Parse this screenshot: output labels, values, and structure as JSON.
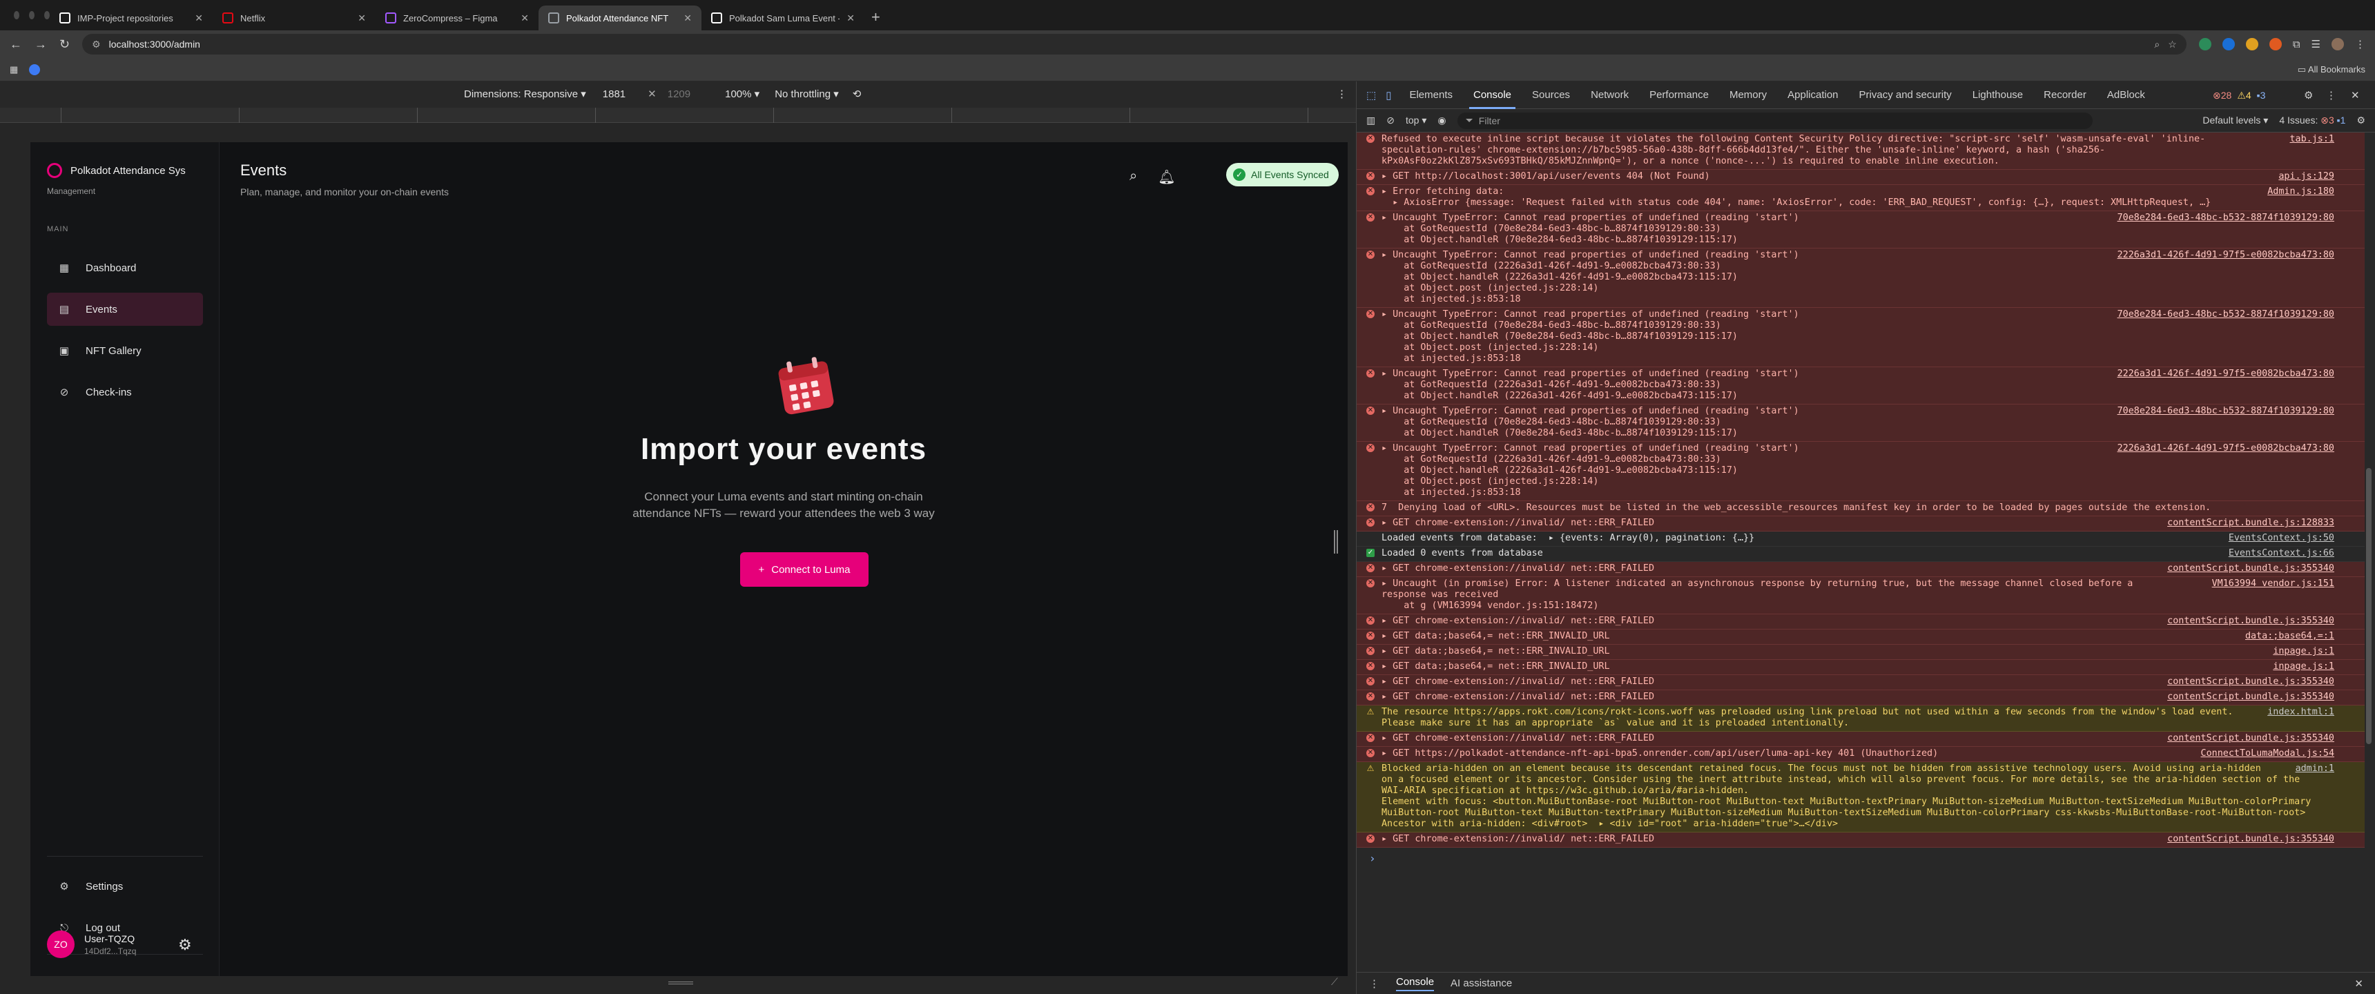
{
  "browser": {
    "tabs": [
      {
        "title": "IMP-Project repositories",
        "icon": "github-icon",
        "color": "#ffffff",
        "active": false
      },
      {
        "title": "Netflix",
        "icon": "netflix-icon",
        "color": "#e50914",
        "active": false
      },
      {
        "title": "ZeroCompress – Figma",
        "icon": "figma-icon",
        "color": "#a259ff",
        "active": false
      },
      {
        "title": "Polkadot Attendance NFT",
        "icon": "page-icon",
        "color": "#9aa0a6",
        "active": true
      },
      {
        "title": "Polkadot Sam Luma Event - L",
        "icon": "page-icon",
        "color": "#ffffff",
        "active": false
      }
    ],
    "url": "localhost:3000/admin",
    "bookmarks_label": "All Bookmarks"
  },
  "device_toolbar": {
    "dimensions_label": "Dimensions: Responsive",
    "width": "1881",
    "height": "1209",
    "zoom": "100%",
    "throttling": "No throttling"
  },
  "app": {
    "brand": "Polkadot Attendance Sys",
    "brand_sub": "Management",
    "section_main": "MAIN",
    "nav": [
      {
        "label": "Dashboard",
        "icon": "grid-icon"
      },
      {
        "label": "Events",
        "icon": "calendar-icon"
      },
      {
        "label": "NFT Gallery",
        "icon": "image-icon"
      },
      {
        "label": "Check-ins",
        "icon": "checkin-icon"
      }
    ],
    "settings": "Settings",
    "logout": "Log out",
    "user": {
      "initials": "ZO",
      "name": "User-TQZQ",
      "address": "14Ddf2...Tqzq"
    },
    "page_title": "Events",
    "page_subtitle": "Plan, manage, and monitor your on-chain events",
    "sync_badge": "All Events Synced",
    "empty_title": "Import your events",
    "empty_desc_1": "Connect your Luma events and start minting on-chain",
    "empty_desc_2": "attendance NFTs — reward your attendees the web 3 way",
    "connect_button": "Connect to Luma",
    "accent": "#e6007a"
  },
  "devtools": {
    "tabs": [
      "Elements",
      "Console",
      "Sources",
      "Network",
      "Performance",
      "Memory",
      "Application",
      "Privacy and security",
      "Lighthouse",
      "Recorder",
      "AdBlock"
    ],
    "active_tab": "Console",
    "counts": {
      "errors": "28",
      "warnings": "4",
      "info": "3"
    },
    "context": "top",
    "filter_placeholder": "Filter",
    "levels": "Default levels",
    "issues": "4 Issues:",
    "issue_counts": {
      "errors": "3",
      "info": "1"
    },
    "drawer_tabs": [
      "Console",
      "AI assistance"
    ],
    "messages": [
      {
        "type": "err",
        "lines": [
          "Refused to execute inline script because it violates the following Content Security Policy directive: \"script-src 'self' 'wasm-unsafe-eval' 'inline-",
          "speculation-rules' chrome-extension://b7bc5985-56a0-438b-8dff-666b4dd13fe4/\". Either the 'unsafe-inline' keyword, a hash ('sha256-",
          "kPx0AsF0oz2kKlZ875xSv693TBHkQ/85kMJZnnWpnQ='), or a nonce ('nonce-...') is required to enable inline execution."
        ],
        "src": "tab.js:1"
      },
      {
        "type": "err",
        "lines": [
          "▸ GET http://localhost:3001/api/user/events 404 (Not Found)"
        ],
        "src": "api.js:129"
      },
      {
        "type": "err",
        "lines": [
          "▸ Error fetching data:",
          "  ▸ AxiosError {message: 'Request failed with status code 404', name: 'AxiosError', code: 'ERR_BAD_REQUEST', config: {…}, request: XMLHttpRequest, …}"
        ],
        "src": "Admin.js:180"
      },
      {
        "type": "err",
        "lines": [
          "▸ Uncaught TypeError: Cannot read properties of undefined (reading 'start')",
          "    at GotRequestId (70e8e284-6ed3-48bc-b…8874f1039129:80:33)",
          "    at Object.handleR (70e8e284-6ed3-48bc-b…8874f1039129:115:17)"
        ],
        "src": "70e8e284-6ed3-48bc-b532-8874f1039129:80"
      },
      {
        "type": "err",
        "lines": [
          "▸ Uncaught TypeError: Cannot read properties of undefined (reading 'start')",
          "    at GotRequestId (2226a3d1-426f-4d91-9…e0082bcba473:80:33)",
          "    at Object.handleR (2226a3d1-426f-4d91-9…e0082bcba473:115:17)",
          "    at Object.post (injected.js:228:14)",
          "    at injected.js:853:18"
        ],
        "src": "2226a3d1-426f-4d91-97f5-e0082bcba473:80"
      },
      {
        "type": "err",
        "lines": [
          "▸ Uncaught TypeError: Cannot read properties of undefined (reading 'start')",
          "    at GotRequestId (70e8e284-6ed3-48bc-b…8874f1039129:80:33)",
          "    at Object.handleR (70e8e284-6ed3-48bc-b…8874f1039129:115:17)",
          "    at Object.post (injected.js:228:14)",
          "    at injected.js:853:18"
        ],
        "src": "70e8e284-6ed3-48bc-b532-8874f1039129:80"
      },
      {
        "type": "err",
        "lines": [
          "▸ Uncaught TypeError: Cannot read properties of undefined (reading 'start')",
          "    at GotRequestId (2226a3d1-426f-4d91-9…e0082bcba473:80:33)",
          "    at Object.handleR (2226a3d1-426f-4d91-9…e0082bcba473:115:17)"
        ],
        "src": "2226a3d1-426f-4d91-97f5-e0082bcba473:80"
      },
      {
        "type": "err",
        "lines": [
          "▸ Uncaught TypeError: Cannot read properties of undefined (reading 'start')",
          "    at GotRequestId (70e8e284-6ed3-48bc-b…8874f1039129:80:33)",
          "    at Object.handleR (70e8e284-6ed3-48bc-b…8874f1039129:115:17)"
        ],
        "src": "70e8e284-6ed3-48bc-b532-8874f1039129:80"
      },
      {
        "type": "err",
        "lines": [
          "▸ Uncaught TypeError: Cannot read properties of undefined (reading 'start')",
          "    at GotRequestId (2226a3d1-426f-4d91-9…e0082bcba473:80:33)",
          "    at Object.handleR (2226a3d1-426f-4d91-9…e0082bcba473:115:17)",
          "    at Object.post (injected.js:228:14)",
          "    at injected.js:853:18"
        ],
        "src": "2226a3d1-426f-4d91-97f5-e0082bcba473:80"
      },
      {
        "type": "err",
        "lines": [
          "7  Denying load of <URL>. Resources must be listed in the web_accessible_resources manifest key in order to be loaded by pages outside the extension."
        ],
        "src": ""
      },
      {
        "type": "err",
        "lines": [
          "▸ GET chrome-extension://invalid/ net::ERR_FAILED"
        ],
        "src": "contentScript.bundle.js:128833"
      },
      {
        "type": "plain",
        "lines": [
          "Loaded events from database:  ▸ {events: Array(0), pagination: {…}}"
        ],
        "src": "EventsContext.js:50"
      },
      {
        "type": "info",
        "lines": [
          "Loaded 0 events from database"
        ],
        "src": "EventsContext.js:66"
      },
      {
        "type": "err",
        "lines": [
          "▸ GET chrome-extension://invalid/ net::ERR_FAILED"
        ],
        "src": "contentScript.bundle.js:355340"
      },
      {
        "type": "err",
        "lines": [
          "▸ Uncaught (in promise) Error: A listener indicated an asynchronous response by returning true, but the message channel closed before a",
          "response was received",
          "    at g (VM163994 vendor.js:151:18472)"
        ],
        "src": "VM163994 vendor.js:151"
      },
      {
        "type": "err",
        "lines": [
          "▸ GET chrome-extension://invalid/ net::ERR_FAILED"
        ],
        "src": "contentScript.bundle.js:355340"
      },
      {
        "type": "err",
        "lines": [
          "▸ GET data:;base64,= net::ERR_INVALID_URL"
        ],
        "src": "data:;base64,=:1"
      },
      {
        "type": "err",
        "lines": [
          "▸ GET data:;base64,= net::ERR_INVALID_URL"
        ],
        "src": "inpage.js:1"
      },
      {
        "type": "err",
        "lines": [
          "▸ GET data:;base64,= net::ERR_INVALID_URL"
        ],
        "src": "inpage.js:1"
      },
      {
        "type": "err",
        "lines": [
          "▸ GET chrome-extension://invalid/ net::ERR_FAILED"
        ],
        "src": "contentScript.bundle.js:355340"
      },
      {
        "type": "err",
        "lines": [
          "▸ GET chrome-extension://invalid/ net::ERR_FAILED"
        ],
        "src": "contentScript.bundle.js:355340"
      },
      {
        "type": "warn",
        "lines": [
          "The resource https://apps.rokt.com/icons/rokt-icons.woff was preloaded using link preload but not used within a few seconds from the window's load event.",
          "Please make sure it has an appropriate `as` value and it is preloaded intentionally."
        ],
        "src": "index.html:1"
      },
      {
        "type": "err",
        "lines": [
          "▸ GET chrome-extension://invalid/ net::ERR_FAILED"
        ],
        "src": "contentScript.bundle.js:355340"
      },
      {
        "type": "err",
        "lines": [
          "▸ GET https://polkadot-attendance-nft-api-bpa5.onrender.com/api/user/luma-api-key 401 (Unauthorized)"
        ],
        "src": "ConnectToLumaModal.js:54"
      },
      {
        "type": "warn",
        "lines": [
          "Blocked aria-hidden on an element because its descendant retained focus. The focus must not be hidden from assistive technology users. Avoid using aria-hidden",
          "on a focused element or its ancestor. Consider using the inert attribute instead, which will also prevent focus. For more details, see the aria-hidden section of the",
          "WAI-ARIA specification at https://w3c.github.io/aria/#aria-hidden.",
          "Element with focus: <button.MuiButtonBase-root MuiButton-root MuiButton-text MuiButton-textPrimary MuiButton-sizeMedium MuiButton-textSizeMedium MuiButton-colorPrimary",
          "MuiButton-root MuiButton-text MuiButton-textPrimary MuiButton-sizeMedium MuiButton-textSizeMedium MuiButton-colorPrimary css-kkwsbs-MuiButtonBase-root-MuiButton-root>",
          "Ancestor with aria-hidden: <div#root>  ▸ <div id=\"root\" aria-hidden=\"true\">…</div>"
        ],
        "src": "admin:1"
      },
      {
        "type": "err",
        "lines": [
          "▸ GET chrome-extension://invalid/ net::ERR_FAILED"
        ],
        "src": "contentScript.bundle.js:355340"
      }
    ]
  }
}
